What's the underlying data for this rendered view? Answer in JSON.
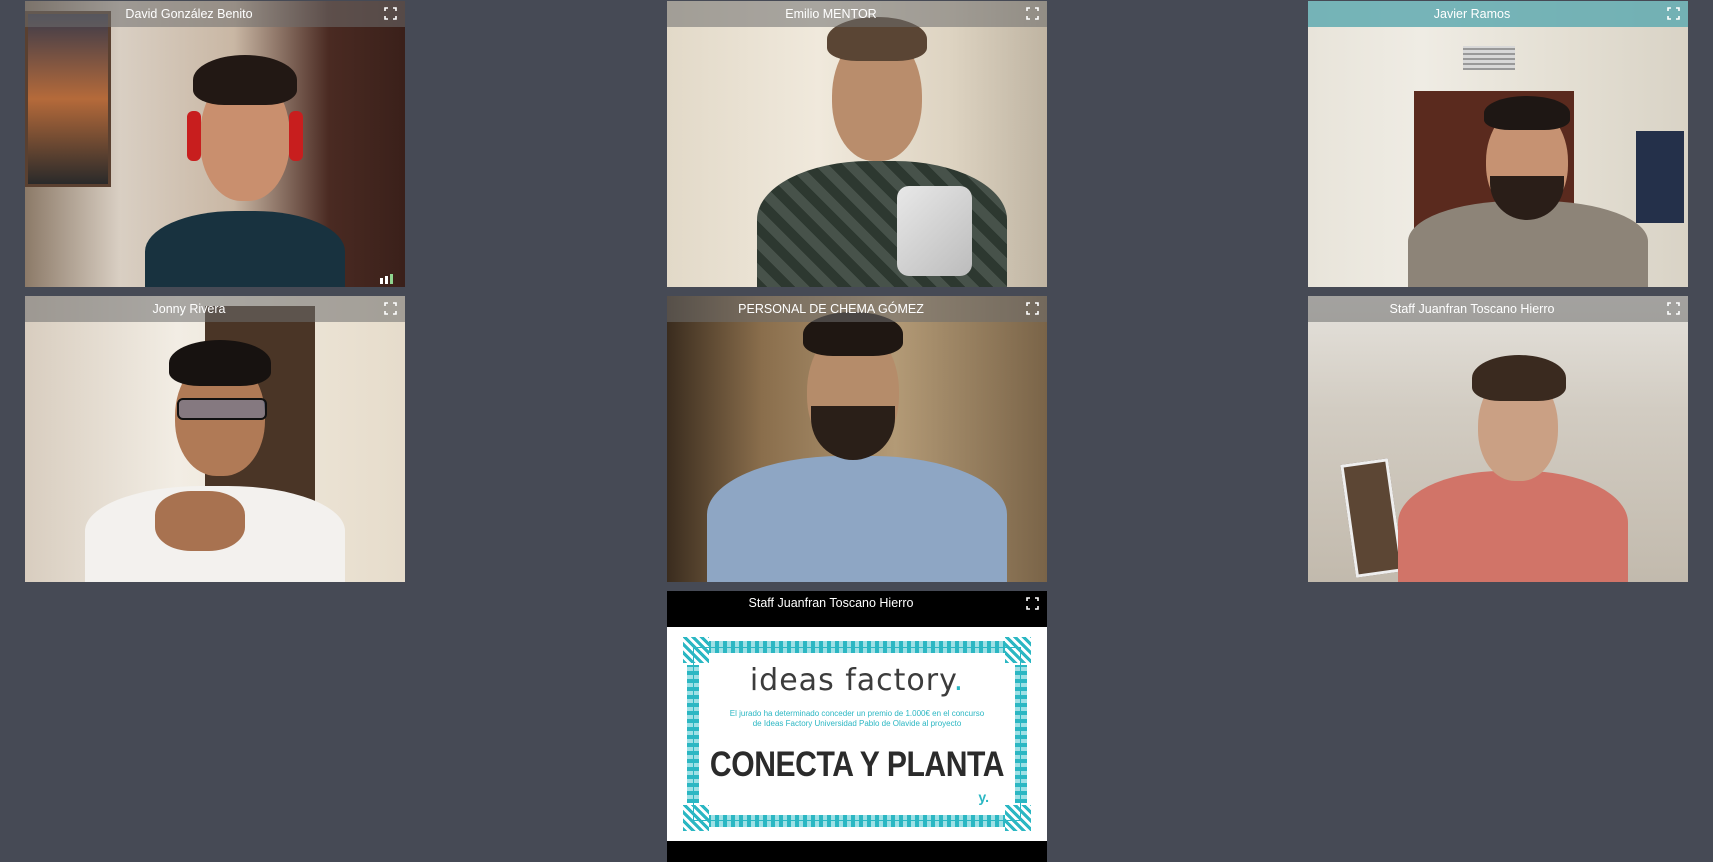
{
  "participants": [
    {
      "name": "David González Benito"
    },
    {
      "name": "Emilio MENTOR"
    },
    {
      "name": "Javier Ramos"
    },
    {
      "name": "Jonny Rivera"
    },
    {
      "name": "PERSONAL DE CHEMA GÓMEZ"
    },
    {
      "name": "Staff Juanfran Toscano Hierro"
    },
    {
      "name": "Staff Juanfran Toscano Hierro"
    }
  ],
  "share": {
    "logo_text": "ideas factory",
    "logo_dot": ".",
    "line1": "El jurado ha determinado conceder un premio de 1.000€ en el concurso",
    "line2": "de Ideas Factory Universidad Pablo de Olavide al proyecto",
    "title": "CONECTA Y PLANTA",
    "mark": "y."
  },
  "icons": {
    "fullscreen": "expand-icon",
    "signal": "signal-strength-icon"
  },
  "colors": {
    "background": "#464a55",
    "accent": "#2bb7c3",
    "active_speaker_bar": "#60aab0"
  }
}
